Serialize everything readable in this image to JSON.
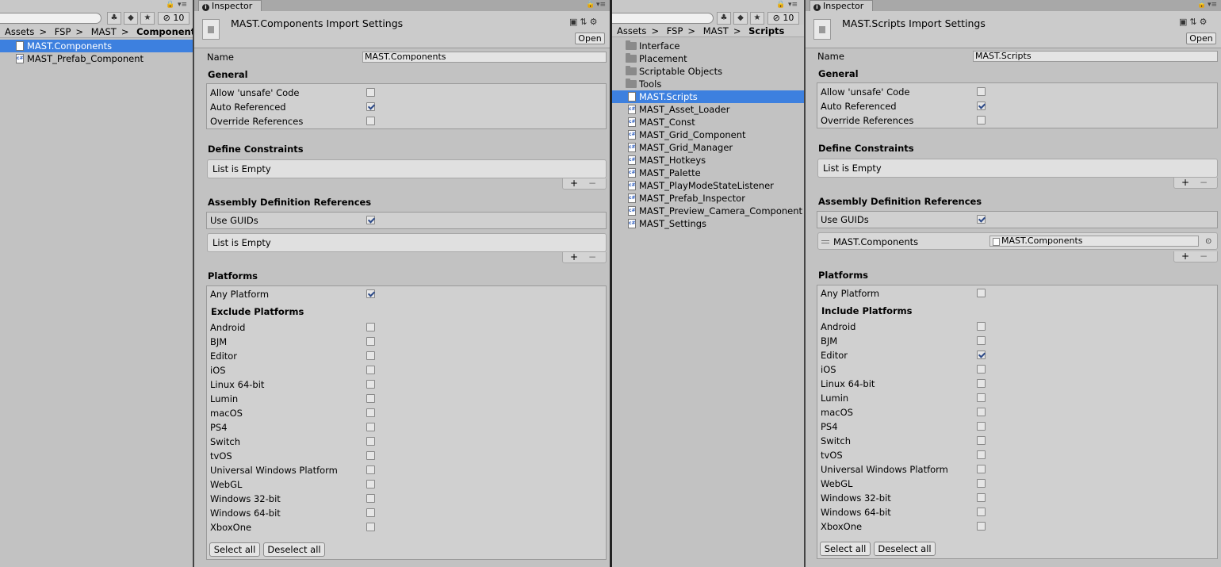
{
  "left_project": {
    "count": "10",
    "breadcrumb": [
      "Assets",
      "FSP",
      "MAST",
      "Component"
    ],
    "items": [
      {
        "label": "MAST.Components",
        "icon": "asmdef-icon",
        "selected": true
      },
      {
        "label": "MAST_Prefab_Component",
        "icon": "cs-script-icon",
        "selected": false
      }
    ]
  },
  "left_inspector": {
    "tab": "Inspector",
    "title": "MAST.Components Import Settings",
    "open_label": "Open",
    "name_label": "Name",
    "name_value": "MAST.Components",
    "general_title": "General",
    "general": [
      {
        "label": "Allow 'unsafe' Code",
        "checked": false
      },
      {
        "label": "Auto Referenced",
        "checked": true
      },
      {
        "label": "Override References",
        "checked": false
      }
    ],
    "define_constraints_title": "Define Constraints",
    "define_constraints_empty": "List is Empty",
    "asm_refs_title": "Assembly Definition References",
    "use_guids_label": "Use GUIDs",
    "use_guids_checked": true,
    "asm_refs_empty": "List is Empty",
    "platforms_title": "Platforms",
    "any_platform_label": "Any Platform",
    "any_platform_checked": true,
    "platform_list_title": "Exclude Platforms",
    "platforms": [
      {
        "label": "Android",
        "checked": false
      },
      {
        "label": "BJM",
        "checked": false
      },
      {
        "label": "Editor",
        "checked": false
      },
      {
        "label": "iOS",
        "checked": false
      },
      {
        "label": "Linux 64-bit",
        "checked": false
      },
      {
        "label": "Lumin",
        "checked": false
      },
      {
        "label": "macOS",
        "checked": false
      },
      {
        "label": "PS4",
        "checked": false
      },
      {
        "label": "Switch",
        "checked": false
      },
      {
        "label": "tvOS",
        "checked": false
      },
      {
        "label": "Universal Windows Platform",
        "checked": false
      },
      {
        "label": "WebGL",
        "checked": false
      },
      {
        "label": "Windows 32-bit",
        "checked": false
      },
      {
        "label": "Windows 64-bit",
        "checked": false
      },
      {
        "label": "XboxOne",
        "checked": false
      }
    ],
    "select_all": "Select all",
    "deselect_all": "Deselect all"
  },
  "right_project": {
    "count": "10",
    "breadcrumb": [
      "Assets",
      "FSP",
      "MAST",
      "Scripts"
    ],
    "items": [
      {
        "label": "Interface",
        "icon": "folder-icon",
        "selected": false
      },
      {
        "label": "Placement",
        "icon": "folder-icon",
        "selected": false
      },
      {
        "label": "Scriptable Objects",
        "icon": "folder-icon",
        "selected": false
      },
      {
        "label": "Tools",
        "icon": "folder-icon",
        "selected": false
      },
      {
        "label": "MAST.Scripts",
        "icon": "asmdef-icon",
        "selected": true
      },
      {
        "label": "MAST_Asset_Loader",
        "icon": "cs-script-icon",
        "selected": false
      },
      {
        "label": "MAST_Const",
        "icon": "cs-script-icon",
        "selected": false
      },
      {
        "label": "MAST_Grid_Component",
        "icon": "cs-script-icon",
        "selected": false
      },
      {
        "label": "MAST_Grid_Manager",
        "icon": "cs-script-icon",
        "selected": false
      },
      {
        "label": "MAST_Hotkeys",
        "icon": "cs-script-icon",
        "selected": false
      },
      {
        "label": "MAST_Palette",
        "icon": "cs-script-icon",
        "selected": false
      },
      {
        "label": "MAST_PlayModeStateListener",
        "icon": "cs-script-icon",
        "selected": false
      },
      {
        "label": "MAST_Prefab_Inspector",
        "icon": "cs-script-icon",
        "selected": false
      },
      {
        "label": "MAST_Preview_Camera_Component",
        "icon": "cs-script-icon",
        "selected": false
      },
      {
        "label": "MAST_Settings",
        "icon": "cs-script-icon",
        "selected": false
      }
    ]
  },
  "right_inspector": {
    "tab": "Inspector",
    "title": "MAST.Scripts Import Settings",
    "open_label": "Open",
    "name_label": "Name",
    "name_value": "MAST.Scripts",
    "general_title": "General",
    "general": [
      {
        "label": "Allow 'unsafe' Code",
        "checked": false
      },
      {
        "label": "Auto Referenced",
        "checked": true
      },
      {
        "label": "Override References",
        "checked": false
      }
    ],
    "define_constraints_title": "Define Constraints",
    "define_constraints_empty": "List is Empty",
    "asm_refs_title": "Assembly Definition References",
    "use_guids_label": "Use GUIDs",
    "use_guids_checked": true,
    "asm_ref_item": {
      "label": "MAST.Components",
      "value": "MAST.Components"
    },
    "platforms_title": "Platforms",
    "any_platform_label": "Any Platform",
    "any_platform_checked": false,
    "platform_list_title": "Include Platforms",
    "platforms": [
      {
        "label": "Android",
        "checked": false
      },
      {
        "label": "BJM",
        "checked": false
      },
      {
        "label": "Editor",
        "checked": true
      },
      {
        "label": "iOS",
        "checked": false
      },
      {
        "label": "Linux 64-bit",
        "checked": false
      },
      {
        "label": "Lumin",
        "checked": false
      },
      {
        "label": "macOS",
        "checked": false
      },
      {
        "label": "PS4",
        "checked": false
      },
      {
        "label": "Switch",
        "checked": false
      },
      {
        "label": "tvOS",
        "checked": false
      },
      {
        "label": "Universal Windows Platform",
        "checked": false
      },
      {
        "label": "WebGL",
        "checked": false
      },
      {
        "label": "Windows 32-bit",
        "checked": false
      },
      {
        "label": "Windows 64-bit",
        "checked": false
      },
      {
        "label": "XboxOne",
        "checked": false
      }
    ],
    "select_all": "Select all",
    "deselect_all": "Deselect all"
  },
  "colors": {
    "selection": "#3d80df",
    "panel_bg": "#c2c2c2",
    "divider": "#222222",
    "checkmark": "#2d4a88"
  }
}
